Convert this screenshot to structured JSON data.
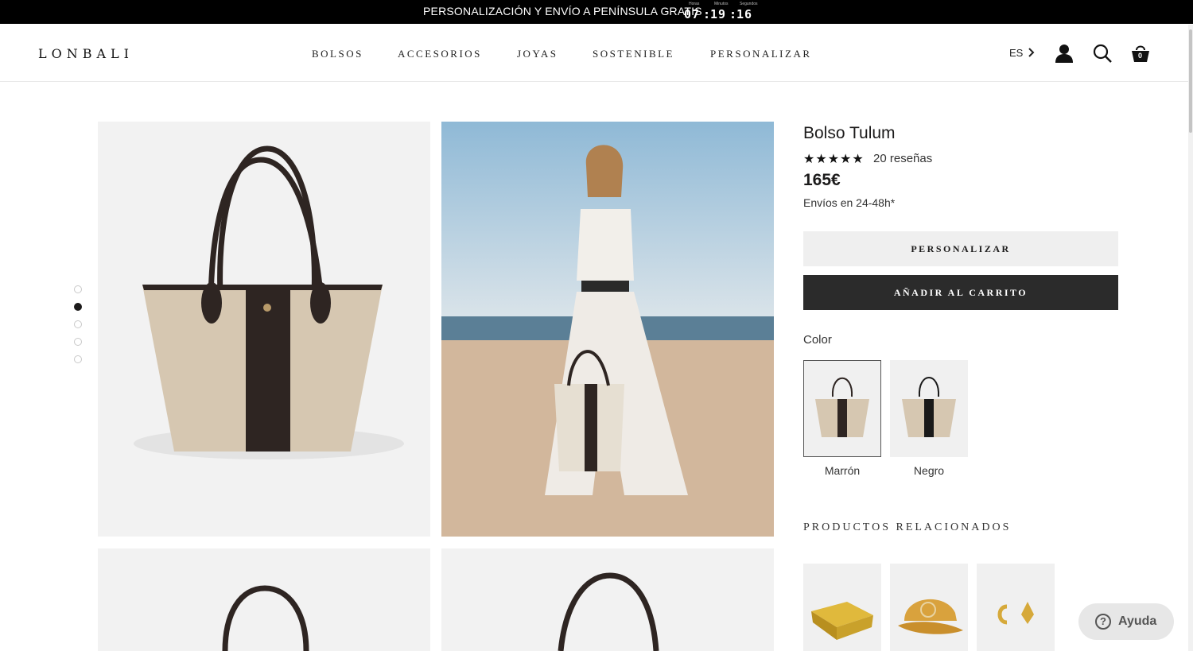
{
  "announcement": {
    "text": "PERSONALIZACIÓN Y ENVÍO A PENÍNSULA GRATIS",
    "countdown": {
      "hours_caption": "Horas",
      "hours": "07",
      "minutes_caption": "Minutos",
      "minutes": "19",
      "seconds_caption": "Segundos",
      "seconds": "16"
    }
  },
  "header": {
    "logo": "LONBALI",
    "nav": [
      "BOLSOS",
      "ACCESORIOS",
      "JOYAS",
      "SOSTENIBLE",
      "PERSONALIZAR"
    ],
    "language": "ES",
    "cart_count": "0",
    "icons": [
      "user-icon",
      "search-icon",
      "cart-icon"
    ]
  },
  "gallery": {
    "dots": 5,
    "active_dot": 2,
    "images": [
      "tote-bag-product-photo",
      "model-on-beach-with-bag",
      "tote-bag-product-photo",
      "tote-bag-product-photo"
    ]
  },
  "product": {
    "title": "Bolso Tulum",
    "stars": "★★★★★",
    "rating": 5,
    "reviews": "20 reseñas",
    "price": "165€",
    "shipping": "Envíos en 24-48h*",
    "personalize_label": "PERSONALIZAR",
    "add_to_cart_label": "AÑADIR AL CARRITO",
    "color_label": "Color",
    "colors": [
      {
        "name": "Marrón",
        "selected": true
      },
      {
        "name": "Negro",
        "selected": false
      }
    ]
  },
  "related": {
    "title": "PRODUCTOS RELACIONADOS",
    "items": [
      "gold-gift-box",
      "mustard-cap",
      "gold-initial-earrings"
    ]
  },
  "help": {
    "label": "Ayuda"
  },
  "colors": {
    "announcement_bg": "#000000",
    "primary_button": "#2b2b2b",
    "secondary_button": "#efefef",
    "gallery_bg": "#f2f2f2",
    "strap": "#2e2522",
    "straw": "#d6c7b1"
  }
}
